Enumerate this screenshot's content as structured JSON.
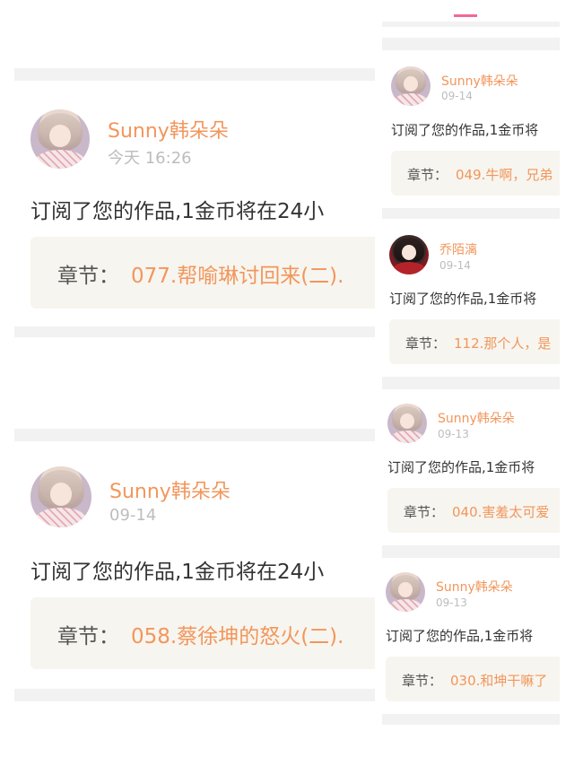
{
  "left_cards": [
    {
      "name": "Sunny韩朵朵",
      "time": "今天 16:26",
      "message": "订阅了您的作品,1金币将在24小",
      "chapter_label": "章节：",
      "chapter_title": "077.帮喻琳讨回来(二)."
    },
    {
      "name": "Sunny韩朵朵",
      "time": "09-14",
      "message": "订阅了您的作品,1金币将在24小",
      "chapter_label": "章节：",
      "chapter_title": "058.蔡徐坤的怒火(二)."
    }
  ],
  "right_cards": [
    {
      "name": "Sunny韩朵朵",
      "time": "09-14",
      "message": "订阅了您的作品,1金币将",
      "chapter_label": "章节：",
      "chapter_title": "049.牛啊，兄弟"
    },
    {
      "name": "乔陌漓",
      "time": "09-14",
      "message": "订阅了您的作品,1金币将",
      "chapter_label": "章节：",
      "chapter_title": "112.那个人，是"
    },
    {
      "name": "Sunny韩朵朵",
      "time": "09-13",
      "message": "订阅了您的作品,1金币将",
      "chapter_label": "章节：",
      "chapter_title": "040.害羞太可爱"
    },
    {
      "name": "Sunny韩朵朵",
      "time": "09-13",
      "message": "订阅了您的作品,1金币将",
      "chapter_label": "章节：",
      "chapter_title": "030.和坤干嘛了"
    }
  ],
  "colors": {
    "accent": "#f2965c",
    "indicator": "#f2679a",
    "chapter_bg": "#f7f5ef"
  }
}
